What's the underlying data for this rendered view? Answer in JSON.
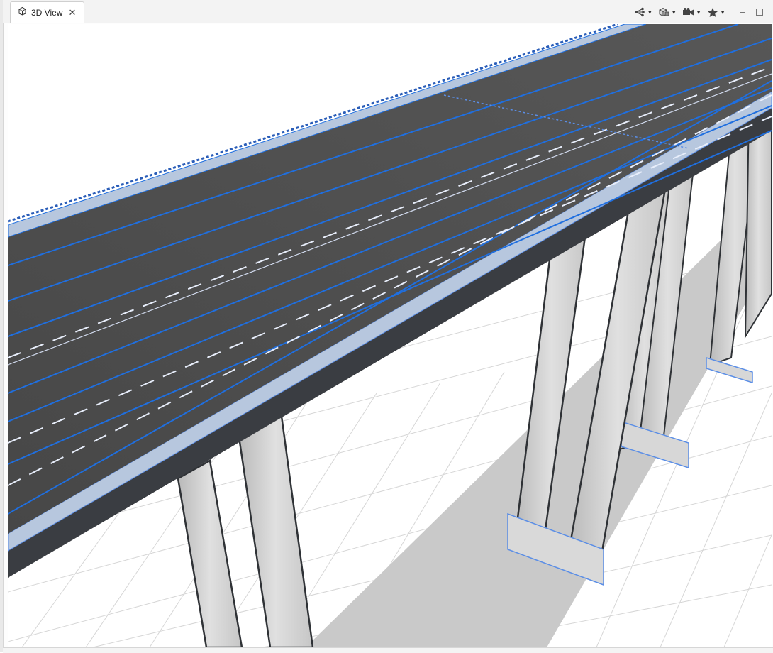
{
  "tab": {
    "label": "3D View",
    "icon": "cube-icon",
    "close_icon": "close-icon"
  },
  "toolbar": {
    "tools": [
      {
        "name": "graph-nodes-icon"
      },
      {
        "name": "box-display-icon"
      },
      {
        "name": "camera-icon"
      },
      {
        "name": "star-icon"
      }
    ],
    "minimize_icon": "minimize-icon",
    "maximize_icon": "maximize-icon"
  },
  "scene": {
    "colors": {
      "asphalt": "#4d4d4d",
      "lane_line": "#1f6fe0",
      "edge_highlight": "#5b8ee6",
      "pier": "#cfcfcf",
      "pier_dark": "#2f3236",
      "shadow": "#c9c9c9",
      "grid": "#d4d4d4",
      "barrier": "#b7c7de"
    }
  }
}
